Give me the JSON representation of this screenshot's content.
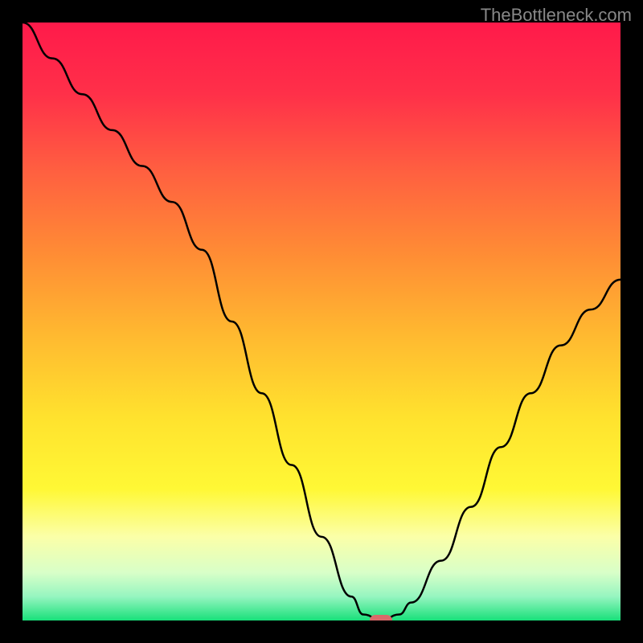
{
  "watermark": "TheBottleneck.com",
  "chart_data": {
    "type": "line",
    "title": "",
    "xlabel": "",
    "ylabel": "",
    "xlim": [
      0,
      100
    ],
    "ylim": [
      0,
      100
    ],
    "background": {
      "type": "vertical-gradient",
      "stops": [
        {
          "pos": 0.0,
          "color": "#ff1a4a"
        },
        {
          "pos": 0.12,
          "color": "#ff3049"
        },
        {
          "pos": 0.25,
          "color": "#ff6040"
        },
        {
          "pos": 0.38,
          "color": "#ff8a35"
        },
        {
          "pos": 0.52,
          "color": "#ffb830"
        },
        {
          "pos": 0.66,
          "color": "#ffe22e"
        },
        {
          "pos": 0.78,
          "color": "#fff835"
        },
        {
          "pos": 0.86,
          "color": "#fbffa8"
        },
        {
          "pos": 0.92,
          "color": "#d8ffc8"
        },
        {
          "pos": 0.96,
          "color": "#96f5c0"
        },
        {
          "pos": 1.0,
          "color": "#18e07a"
        }
      ]
    },
    "series": [
      {
        "name": "bottleneck-curve",
        "color": "#000000",
        "x": [
          0,
          5,
          10,
          15,
          20,
          25,
          30,
          35,
          40,
          45,
          50,
          55,
          57,
          60,
          63,
          65,
          70,
          75,
          80,
          85,
          90,
          95,
          100
        ],
        "y": [
          100,
          94,
          88,
          82,
          76,
          70,
          62,
          50,
          38,
          26,
          14,
          4,
          1,
          0,
          1,
          3,
          10,
          19,
          29,
          38,
          46,
          52,
          57
        ]
      }
    ],
    "marker": {
      "name": "optimal-point",
      "x": 60,
      "y": 0,
      "color": "#d96a6a"
    }
  }
}
